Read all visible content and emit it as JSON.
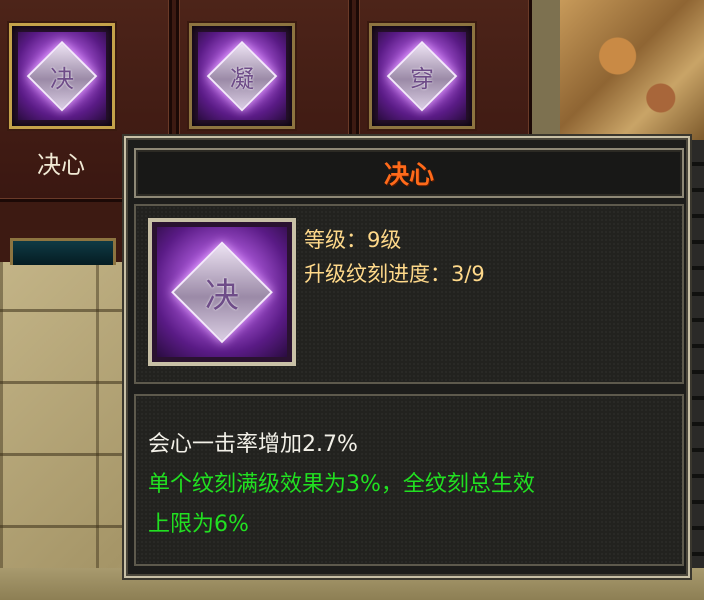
{
  "colors": {
    "title": "#ff6a1a",
    "info_text": "#ffd98a",
    "desc_text": "#f2f0e8",
    "highlight_text": "#21e021",
    "grid_bg": "#3d1a12",
    "rune_glow": "#b25ee0"
  },
  "grid": {
    "items": [
      {
        "rune_char": "决",
        "label": "决心",
        "icon": "rune-jue-icon",
        "selected": true
      },
      {
        "rune_char": "凝",
        "label": "",
        "icon": "rune-ning-icon",
        "selected": false
      },
      {
        "rune_char": "穿",
        "label": "",
        "icon": "rune-chuan-icon",
        "selected": false
      }
    ]
  },
  "tooltip": {
    "title": "决心",
    "icon": {
      "rune_char": "决",
      "name": "rune-jue-icon"
    },
    "level_line": "等级：9级",
    "progress_line": "升级纹刻进度：3/9",
    "desc_main": "会心一击率增加2.7%",
    "desc_green_1": "单个纹刻满级效果为3%，全纹刻总生效",
    "desc_green_2": "上限为6%"
  }
}
